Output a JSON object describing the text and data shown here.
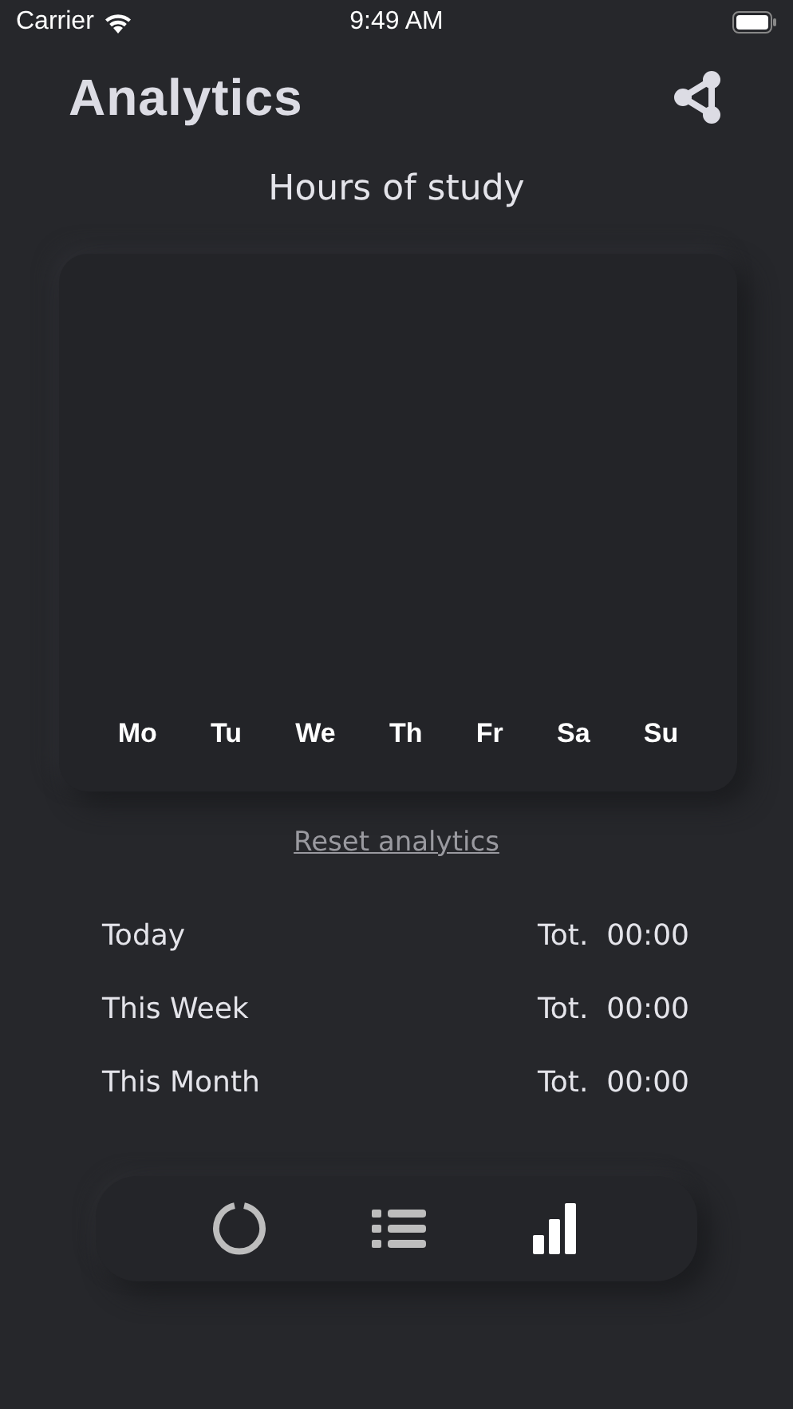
{
  "status_bar": {
    "carrier": "Carrier",
    "time": "9:49 AM"
  },
  "header": {
    "title": "Analytics"
  },
  "chart": {
    "title": "Hours of study",
    "days": [
      "Mo",
      "Tu",
      "We",
      "Th",
      "Fr",
      "Sa",
      "Su"
    ]
  },
  "reset_link": "Reset analytics",
  "stats": [
    {
      "label": "Today",
      "prefix": "Tot.",
      "value": "00:00"
    },
    {
      "label": "This Week",
      "prefix": "Tot.",
      "value": "00:00"
    },
    {
      "label": "This Month",
      "prefix": "Tot.",
      "value": "00:00"
    }
  ],
  "tabs": [
    {
      "kind": "timer",
      "selected": false
    },
    {
      "kind": "list",
      "selected": false
    },
    {
      "kind": "stats",
      "selected": true
    }
  ]
}
